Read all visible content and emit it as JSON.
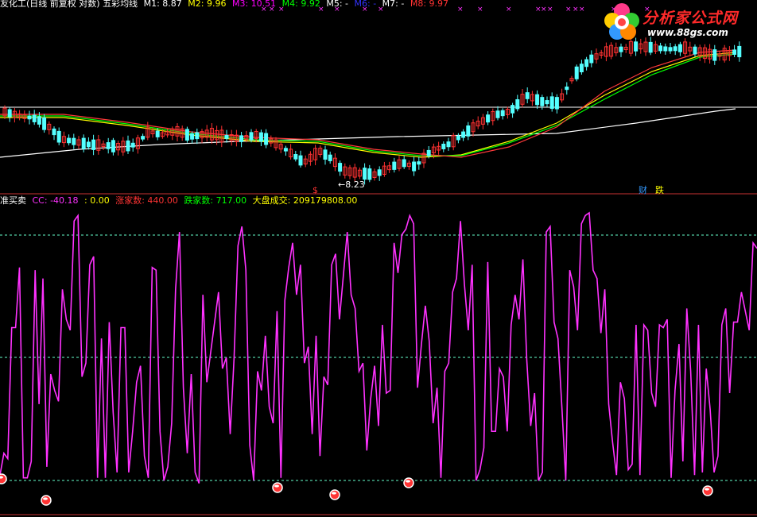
{
  "top_header": {
    "title": "友化工(日线 前复权 对数) 五彩均线",
    "m1": "M1: 8.87",
    "m2": "M2: 9.96",
    "m3": "M3: 10.51",
    "m4": "M4: 9.92",
    "m5": "M5: -",
    "m6": "M6: -",
    "m7": "M7: -",
    "m8": "M8: 9.97"
  },
  "indicator_header": {
    "name": "准买卖",
    "cc": "CC: -40.18",
    "val": ": 0.00",
    "up_label": "涨家数: 440.00",
    "down_label": "跌家数: 717.00",
    "volume_label": "大盘成交: 209179808.00"
  },
  "annotations": {
    "low_price": "←8.23",
    "dollar": "$",
    "cai": "财",
    "die": "跌"
  },
  "logo": {
    "text": "分析家公式网",
    "url": "www.88gs.com"
  },
  "colors": {
    "bg": "#000000",
    "up_candle": "#ff3232",
    "down_candle": "#54ffff",
    "oscillator": "#ff32ff",
    "ma_white": "#ffffff",
    "ma_yellow": "#ffff00",
    "ma_green": "#00ff00",
    "ma_red": "#ff3a3a",
    "dashed_line": "#66ffcc"
  },
  "oscillator": {
    "values": [
      0.04,
      0.12,
      0.1,
      0.58,
      0.58,
      0.8,
      0.03,
      0.03,
      0.09,
      0.79,
      0.3,
      0.76,
      0.07,
      0.41,
      0.35,
      0.31,
      0.72,
      0.61,
      0.57,
      0.97,
      0.99,
      0.4,
      0.45,
      0.81,
      0.84,
      0.03,
      0.54,
      0.03,
      0.6,
      0.27,
      0.05,
      0.58,
      0.58,
      0.05,
      0.2,
      0.38,
      0.44,
      0.11,
      0.03,
      0.8,
      0.79,
      0.2,
      0.02,
      0.07,
      0.23,
      0.72,
      0.93,
      0.36,
      0.12,
      0.41,
      0.05,
      0.01,
      0.7,
      0.38,
      0.49,
      0.6,
      0.71,
      0.43,
      0.47,
      0.19,
      0.47,
      0.88,
      0.95,
      0.79,
      0.15,
      0.02,
      0.42,
      0.35,
      0.55,
      0.29,
      0.23,
      0.64,
      0.03,
      0.68,
      0.8,
      0.89,
      0.7,
      0.81,
      0.45,
      0.51,
      0.19,
      0.55,
      0.11,
      0.4,
      0.37,
      0.81,
      0.85,
      0.61,
      0.77,
      0.93,
      0.7,
      0.65,
      0.42,
      0.45,
      0.13,
      0.32,
      0.44,
      0.22,
      0.59,
      0.34,
      0.35,
      0.89,
      0.78,
      0.92,
      0.94,
      0.99,
      0.96,
      0.36,
      0.52,
      0.66,
      0.53,
      0.23,
      0.36,
      0.03,
      0.42,
      0.45,
      0.71,
      0.76,
      0.97,
      0.74,
      0.57,
      0.81,
      0.02,
      0.06,
      0.14,
      0.82,
      0.2,
      0.2,
      0.43,
      0.4,
      0.2,
      0.59,
      0.7,
      0.61,
      0.83,
      0.46,
      0.22,
      0.34,
      0.02,
      0.05,
      0.93,
      0.95,
      0.6,
      0.54,
      0.29,
      0.02,
      0.79,
      0.73,
      0.57,
      0.96,
      0.99,
      1.0,
      0.79,
      0.76,
      0.56,
      0.72,
      0.3,
      0.16,
      0.04,
      0.38,
      0.32,
      0.06,
      0.08,
      0.59,
      0.04,
      0.59,
      0.57,
      0.34,
      0.29,
      0.59,
      0.58,
      0.61,
      0.03,
      0.35,
      0.52,
      0.09,
      0.65,
      0.42,
      0.04,
      0.59,
      0.05,
      0.43,
      0.28,
      0.05,
      0.11,
      0.59,
      0.65,
      0.34,
      0.6,
      0.6,
      0.71,
      0.64,
      0.57,
      0.89,
      0.87
    ]
  }
}
